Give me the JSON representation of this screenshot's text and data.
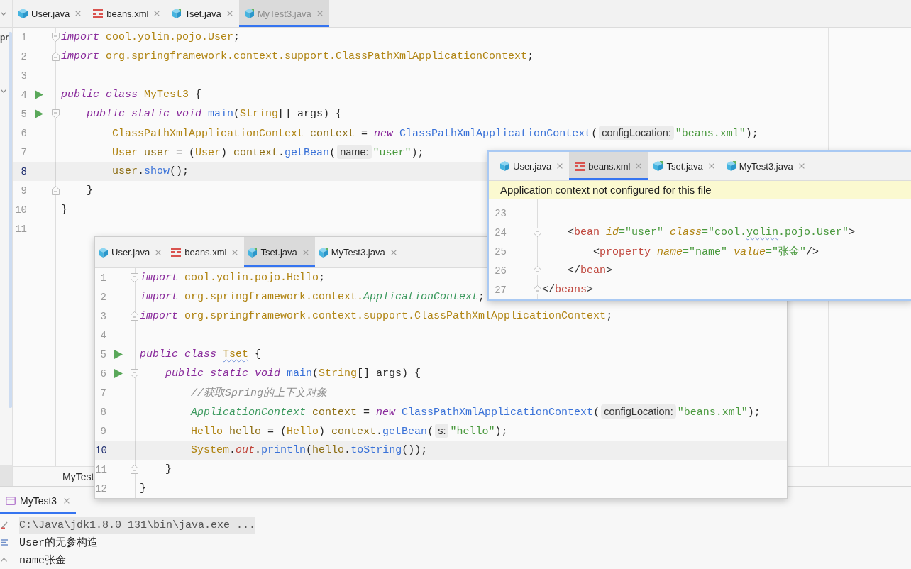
{
  "left_panel": {
    "label": "pr"
  },
  "editor": {
    "tabs": [
      {
        "label": "User.java",
        "kind": "class",
        "selected": false
      },
      {
        "label": "beans.xml",
        "kind": "xml",
        "selected": false
      },
      {
        "label": "Tset.java",
        "kind": "runnable",
        "selected": false
      },
      {
        "label": "MyTest3.java",
        "kind": "runnable",
        "selected": true
      }
    ],
    "lines": [
      {
        "number": "1",
        "current": false,
        "run": false,
        "fold": {
          "kind": "start"
        },
        "tokens": [
          {
            "kind": "kw",
            "text": "import "
          },
          {
            "kind": "type",
            "text": "cool.yolin.pojo.User"
          },
          {
            "kind": "plain",
            "text": ";"
          }
        ]
      },
      {
        "number": "2",
        "current": false,
        "run": false,
        "fold": {
          "kind": "end"
        },
        "tokens": [
          {
            "kind": "kw",
            "text": "import "
          },
          {
            "kind": "type",
            "text": "org.springframework.context.support.ClassPathXmlApplicationContext"
          },
          {
            "kind": "plain",
            "text": ";"
          }
        ]
      },
      {
        "number": "3",
        "current": false,
        "run": false
      },
      {
        "number": "4",
        "current": false,
        "run": true,
        "tokens": [
          {
            "kind": "kw",
            "text": "public class "
          },
          {
            "kind": "type",
            "text": "MyTest3 "
          },
          {
            "kind": "plain",
            "text": "{"
          }
        ]
      },
      {
        "number": "5",
        "current": false,
        "run": true,
        "fold": {
          "kind": "start"
        },
        "tokens": [
          {
            "kind": "kw",
            "text": "    public static void "
          },
          {
            "kind": "method",
            "text": "main"
          },
          {
            "kind": "plain",
            "text": "("
          },
          {
            "kind": "type",
            "text": "String"
          },
          {
            "kind": "plain",
            "text": "[] args) {"
          }
        ]
      },
      {
        "number": "6",
        "current": false,
        "run": false,
        "tokens": [
          {
            "kind": "type",
            "text": "        ClassPathXmlApplicationContext "
          },
          {
            "kind": "var",
            "text": "context "
          },
          {
            "kind": "plain",
            "text": "= "
          },
          {
            "kind": "kw",
            "text": "new "
          },
          {
            "kind": "method",
            "text": "ClassPathXmlApplicationContext"
          },
          {
            "kind": "plain",
            "text": "("
          },
          {
            "kind": "hint",
            "text": "configLocation:"
          },
          {
            "kind": "str",
            "text": "\"beans.xml\""
          },
          {
            "kind": "plain",
            "text": ");"
          }
        ]
      },
      {
        "number": "7",
        "current": false,
        "run": false,
        "tokens": [
          {
            "kind": "type",
            "text": "        User "
          },
          {
            "kind": "var",
            "text": "user "
          },
          {
            "kind": "plain",
            "text": "= ("
          },
          {
            "kind": "type",
            "text": "User"
          },
          {
            "kind": "plain",
            "text": ") "
          },
          {
            "kind": "var",
            "text": "context"
          },
          {
            "kind": "plain",
            "text": "."
          },
          {
            "kind": "method",
            "text": "getBean"
          },
          {
            "kind": "plain",
            "text": "("
          },
          {
            "kind": "hint",
            "text": "name:"
          },
          {
            "kind": "str",
            "text": "\"user\""
          },
          {
            "kind": "plain",
            "text": ");"
          }
        ]
      },
      {
        "number": "8",
        "current": true,
        "run": false,
        "tokens": [
          {
            "kind": "var",
            "text": "        user"
          },
          {
            "kind": "plain",
            "text": "."
          },
          {
            "kind": "method",
            "text": "show"
          },
          {
            "kind": "plain",
            "text": "();"
          }
        ]
      },
      {
        "number": "9",
        "current": false,
        "run": false,
        "fold": {
          "kind": "end"
        },
        "tokens": [
          {
            "kind": "plain",
            "text": "    }"
          }
        ]
      },
      {
        "number": "10",
        "current": false,
        "run": false,
        "tokens": [
          {
            "kind": "plain",
            "text": "}"
          }
        ]
      },
      {
        "number": "11",
        "current": false,
        "run": false
      }
    ],
    "breadcrumb": "MyTest"
  },
  "popups": [
    {
      "tabs": [
        {
          "label": "User.java",
          "kind": "class",
          "selected": false
        },
        {
          "label": "beans.xml",
          "kind": "xml",
          "selected": false
        },
        {
          "label": "Tset.java",
          "kind": "runnable",
          "selected": true
        },
        {
          "label": "MyTest3.java",
          "kind": "runnable",
          "selected": false
        }
      ],
      "lines": [
        {
          "number": "1",
          "current": false,
          "run": false,
          "fold": {
            "kind": "start"
          },
          "tokens": [
            {
              "kind": "kw",
              "text": "import "
            },
            {
              "kind": "type",
              "text": "cool.yolin.pojo.Hello"
            },
            {
              "kind": "plain",
              "text": ";"
            }
          ]
        },
        {
          "number": "2",
          "current": false,
          "run": false,
          "tokens": [
            {
              "kind": "kw",
              "text": "import "
            },
            {
              "kind": "type",
              "text": "org.springframework.context."
            },
            {
              "kind": "iface",
              "text": "ApplicationContext"
            },
            {
              "kind": "plain",
              "text": ";"
            }
          ]
        },
        {
          "number": "3",
          "current": false,
          "run": false,
          "fold": {
            "kind": "end"
          },
          "tokens": [
            {
              "kind": "kw",
              "text": "import "
            },
            {
              "kind": "type",
              "text": "org.springframework.context.support.ClassPathXmlApplicationContext"
            },
            {
              "kind": "plain",
              "text": ";"
            }
          ]
        },
        {
          "number": "4",
          "current": false,
          "run": false
        },
        {
          "number": "5",
          "current": false,
          "run": true,
          "tokens": [
            {
              "kind": "kw",
              "text": "public class "
            },
            {
              "kind": "typo",
              "text": "Tset"
            },
            {
              "kind": "plain",
              "text": " {"
            }
          ]
        },
        {
          "number": "6",
          "current": false,
          "run": true,
          "fold": {
            "kind": "start"
          },
          "tokens": [
            {
              "kind": "kw",
              "text": "    public static void "
            },
            {
              "kind": "method",
              "text": "main"
            },
            {
              "kind": "plain",
              "text": "("
            },
            {
              "kind": "type",
              "text": "String"
            },
            {
              "kind": "plain",
              "text": "[] args) {"
            }
          ]
        },
        {
          "number": "7",
          "current": false,
          "run": false,
          "tokens": [
            {
              "kind": "comment",
              "text": "        //获取Spring的上下文对象"
            }
          ]
        },
        {
          "number": "8",
          "current": false,
          "run": false,
          "tokens": [
            {
              "kind": "iface",
              "text": "        ApplicationContext "
            },
            {
              "kind": "var",
              "text": "context "
            },
            {
              "kind": "plain",
              "text": "= "
            },
            {
              "kind": "kw",
              "text": "new "
            },
            {
              "kind": "method",
              "text": "ClassPathXmlApplicationContext"
            },
            {
              "kind": "plain",
              "text": "("
            },
            {
              "kind": "hint",
              "text": "configLocation:"
            },
            {
              "kind": "str",
              "text": "\"beans.xml\""
            },
            {
              "kind": "plain",
              "text": ");"
            }
          ]
        },
        {
          "number": "9",
          "current": false,
          "run": false,
          "tokens": [
            {
              "kind": "type",
              "text": "        Hello "
            },
            {
              "kind": "var",
              "text": "hello "
            },
            {
              "kind": "plain",
              "text": "= ("
            },
            {
              "kind": "type",
              "text": "Hello"
            },
            {
              "kind": "plain",
              "text": ") "
            },
            {
              "kind": "var",
              "text": "context"
            },
            {
              "kind": "plain",
              "text": "."
            },
            {
              "kind": "method",
              "text": "getBean"
            },
            {
              "kind": "plain",
              "text": "("
            },
            {
              "kind": "hint",
              "text": "s:"
            },
            {
              "kind": "str",
              "text": "\"hello\""
            },
            {
              "kind": "plain",
              "text": ");"
            }
          ]
        },
        {
          "number": "10",
          "current": true,
          "run": false,
          "tokens": [
            {
              "kind": "type",
              "text": "        System"
            },
            {
              "kind": "plain",
              "text": "."
            },
            {
              "kind": "field",
              "text": "out"
            },
            {
              "kind": "plain",
              "text": "."
            },
            {
              "kind": "method",
              "text": "println"
            },
            {
              "kind": "plain",
              "text": "("
            },
            {
              "kind": "var",
              "text": "hello"
            },
            {
              "kind": "plain",
              "text": "."
            },
            {
              "kind": "method",
              "text": "toString"
            },
            {
              "kind": "plain",
              "text": "());"
            }
          ]
        },
        {
          "number": "11",
          "current": false,
          "run": false,
          "fold": {
            "kind": "end"
          },
          "tokens": [
            {
              "kind": "plain",
              "text": "    }"
            }
          ]
        },
        {
          "number": "12",
          "current": false,
          "run": false,
          "tokens": [
            {
              "kind": "plain",
              "text": "}"
            }
          ]
        }
      ]
    },
    {
      "tabs": [
        {
          "label": "User.java",
          "kind": "class",
          "selected": false
        },
        {
          "label": "beans.xml",
          "kind": "xml",
          "selected": true
        },
        {
          "label": "Tset.java",
          "kind": "runnable",
          "selected": false
        },
        {
          "label": "MyTest3.java",
          "kind": "runnable",
          "selected": false
        }
      ],
      "banner": "Application context not configured for this file",
      "lines": [
        {
          "number": "23",
          "current": false,
          "run": false
        },
        {
          "number": "24",
          "current": false,
          "run": false,
          "fold": {
            "kind": "start"
          },
          "tokens": [
            {
              "kind": "plain",
              "text": "    <"
            },
            {
              "kind": "tag",
              "text": "bean "
            },
            {
              "kind": "attr",
              "text": "id"
            },
            {
              "kind": "str",
              "text": "=\"user\" "
            },
            {
              "kind": "attr",
              "text": "class"
            },
            {
              "kind": "str",
              "text": "=\"cool."
            },
            {
              "kind": "strtypo",
              "text": "yolin"
            },
            {
              "kind": "str",
              "text": ".pojo.User\""
            },
            {
              "kind": "plain",
              "text": ">"
            }
          ]
        },
        {
          "number": "25",
          "current": false,
          "run": false,
          "tokens": [
            {
              "kind": "plain",
              "text": "        <"
            },
            {
              "kind": "tag",
              "text": "property "
            },
            {
              "kind": "attr",
              "text": "name"
            },
            {
              "kind": "str",
              "text": "=\"name\" "
            },
            {
              "kind": "attr",
              "text": "value"
            },
            {
              "kind": "str",
              "text": "=\"张金\""
            },
            {
              "kind": "plain",
              "text": "/>"
            }
          ]
        },
        {
          "number": "26",
          "current": false,
          "run": false,
          "fold": {
            "kind": "end"
          },
          "tokens": [
            {
              "kind": "plain",
              "text": "    </"
            },
            {
              "kind": "tag",
              "text": "bean"
            },
            {
              "kind": "plain",
              "text": ">"
            }
          ]
        },
        {
          "number": "27",
          "current": false,
          "run": false,
          "fold": {
            "kind": "end"
          },
          "tokens": [
            {
              "kind": "plain",
              "text": "</"
            },
            {
              "kind": "tag",
              "text": "beans"
            },
            {
              "kind": "plain",
              "text": ">"
            }
          ]
        }
      ]
    }
  ],
  "run_panel": {
    "tab": {
      "label": "MyTest3",
      "selected": true
    },
    "console": [
      {
        "kind": "command",
        "text": "C:\\Java\\jdk1.8.0_131\\bin\\java.exe ..."
      },
      {
        "kind": "output",
        "text": "User的无参构造"
      },
      {
        "kind": "output",
        "text": "name张金"
      }
    ]
  }
}
